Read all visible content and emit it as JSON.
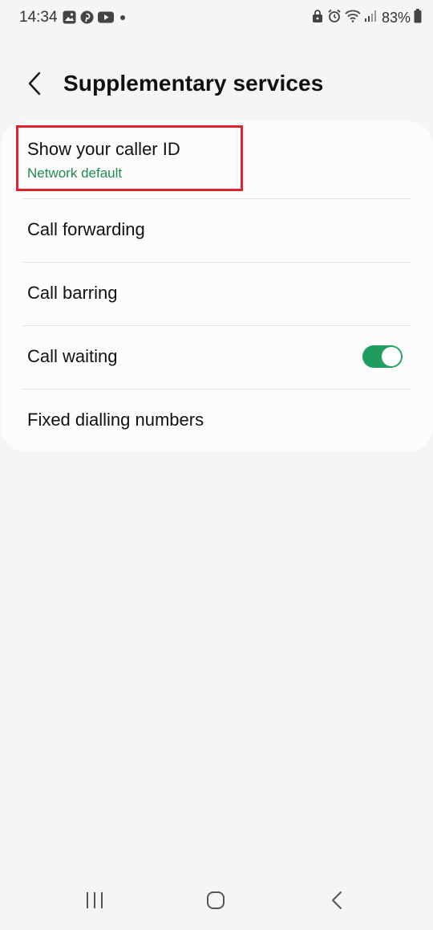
{
  "status_bar": {
    "time": "14:34",
    "notification_icons": [
      "gallery-icon",
      "pinterest-icon",
      "youtube-icon",
      "dot-icon"
    ],
    "system_icons": [
      "lock-icon",
      "alarm-icon",
      "wifi-icon",
      "signal-icon",
      "battery-icon"
    ],
    "battery": "83%"
  },
  "header": {
    "back_icon": "chevron-left-icon",
    "title": "Supplementary services"
  },
  "settings": {
    "items": [
      {
        "label": "Show your caller ID",
        "sub": "Network default"
      },
      {
        "label": "Call forwarding"
      },
      {
        "label": "Call barring"
      },
      {
        "label": "Call waiting",
        "toggle_on": true
      },
      {
        "label": "Fixed dialling numbers"
      }
    ]
  },
  "colors": {
    "accent_green": "#1f9d5e",
    "subtext_green": "#1f8a52",
    "highlight_red": "#e0242f",
    "background": "#f5f5f5",
    "card": "#fcfcfc"
  },
  "nav_bar": {
    "icons": [
      "recents-icon",
      "home-icon",
      "back-icon"
    ]
  }
}
